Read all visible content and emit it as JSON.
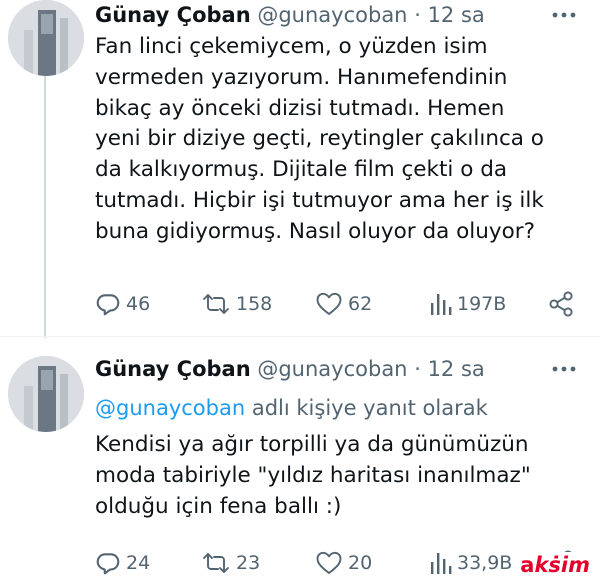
{
  "tweets": [
    {
      "author_name": "Günay Çoban",
      "author_handle": "@gunaycoban",
      "separator": "·",
      "time": "12 sa",
      "text": "Fan linci çekemiycem, o yüzden isim\nvermeden yazıyorum. Hanımefendinin\nbikaç ay önceki dizisi tutmadı. Hemen\nyeni bir diziye geçti, reytingler çakılınca o\nda kalkıyormuş. Dijitale film çekti o da\ntutmadı. Hiçbir işi tutmuyor ama her iş ilk\nbuna gidiyormuş. Nasıl oluyor da oluyor?",
      "stats": {
        "replies": "46",
        "retweets": "158",
        "likes": "62",
        "views": "197B"
      }
    },
    {
      "author_name": "Günay Çoban",
      "author_handle": "@gunaycoban",
      "separator": "·",
      "time": "12 sa",
      "reply_to_handle": "@gunaycoban",
      "reply_to_suffix": "adlı kişiye yanıt olarak",
      "text": "Kendisi ya ağır torpilli ya da günümüzün\nmoda tabiriyle \"yıldız haritası inanılmaz\"\nolduğu için fena ballı :)",
      "stats": {
        "replies": "24",
        "retweets": "23",
        "likes": "20",
        "views": "33,9B"
      }
    }
  ],
  "icons": {
    "reply": "reply-icon",
    "retweet": "retweet-icon",
    "like": "heart-icon",
    "views": "views-icon",
    "share": "share-icon",
    "more": "more-icon"
  },
  "watermark": {
    "part1": "a",
    "part2": "kṡim"
  },
  "colors": {
    "text": "#0f1419",
    "secondary": "#536471",
    "link": "#1d9bf0",
    "divider": "#eff3f4",
    "watermark": "#e4002b"
  }
}
